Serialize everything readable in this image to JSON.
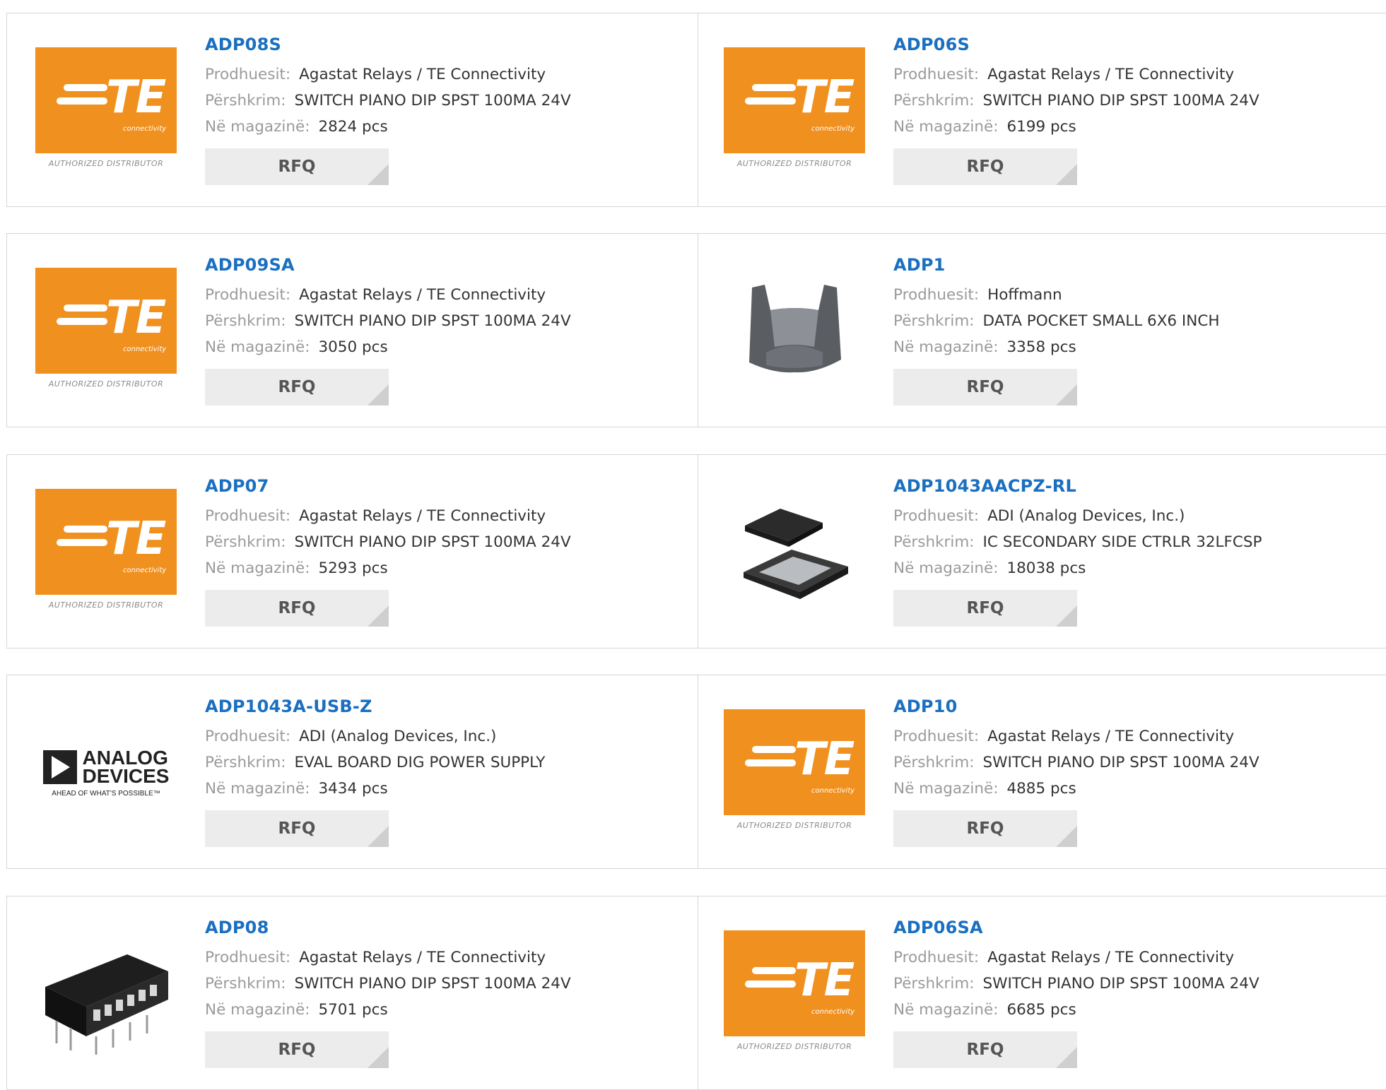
{
  "labels": {
    "manufacturer": "Prodhuesit:",
    "description": "Përshkrim:",
    "stock": "Në magazinë:",
    "rfq": "RFQ"
  },
  "logos": {
    "te_word": "TE",
    "te_sub": "connectivity",
    "te_auth": "AUTHORIZED DISTRIBUTOR",
    "adi_line1": "ANALOG",
    "adi_line2": "DEVICES",
    "adi_tag": "AHEAD OF WHAT'S POSSIBLE™"
  },
  "colors": {
    "link": "#1a6fc0",
    "te_orange": "#f0901e",
    "rfq_bg": "#ececec"
  },
  "products": [
    {
      "pn": "ADP08S",
      "manufacturer": "Agastat Relays / TE Connectivity",
      "description": "SWITCH PIANO DIP SPST 100MA 24V",
      "stock": "2824 pcs",
      "image": "te-logo"
    },
    {
      "pn": "ADP06S",
      "manufacturer": "Agastat Relays / TE Connectivity",
      "description": "SWITCH PIANO DIP SPST 100MA 24V",
      "stock": "6199 pcs",
      "image": "te-logo"
    },
    {
      "pn": "ADP09SA",
      "manufacturer": "Agastat Relays / TE Connectivity",
      "description": "SWITCH PIANO DIP SPST 100MA 24V",
      "stock": "3050 pcs",
      "image": "te-logo"
    },
    {
      "pn": "ADP1",
      "manufacturer": "Hoffmann",
      "description": "DATA POCKET SMALL 6X6 INCH",
      "stock": "3358 pcs",
      "image": "data-pocket"
    },
    {
      "pn": "ADP07",
      "manufacturer": "Agastat Relays / TE Connectivity",
      "description": "SWITCH PIANO DIP SPST 100MA 24V",
      "stock": "5293 pcs",
      "image": "te-logo"
    },
    {
      "pn": "ADP1043AACPZ-RL",
      "manufacturer": "ADI (Analog Devices, Inc.)",
      "description": "IC SECONDARY SIDE CTRLR 32LFCSP",
      "stock": "18038 pcs",
      "image": "ic-chip"
    },
    {
      "pn": "ADP1043A-USB-Z",
      "manufacturer": "ADI (Analog Devices, Inc.)",
      "description": "EVAL BOARD DIG POWER SUPPLY",
      "stock": "3434 pcs",
      "image": "adi-logo"
    },
    {
      "pn": "ADP10",
      "manufacturer": "Agastat Relays / TE Connectivity",
      "description": "SWITCH PIANO DIP SPST 100MA 24V",
      "stock": "4885 pcs",
      "image": "te-logo"
    },
    {
      "pn": "ADP08",
      "manufacturer": "Agastat Relays / TE Connectivity",
      "description": "SWITCH PIANO DIP SPST 100MA 24V",
      "stock": "5701 pcs",
      "image": "dip-switch"
    },
    {
      "pn": "ADP06SA",
      "manufacturer": "Agastat Relays / TE Connectivity",
      "description": "SWITCH PIANO DIP SPST 100MA 24V",
      "stock": "6685 pcs",
      "image": "te-logo"
    }
  ]
}
